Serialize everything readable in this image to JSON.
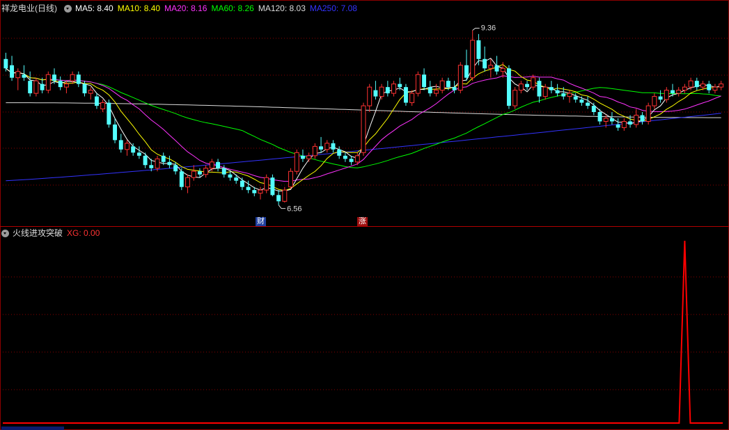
{
  "header": {
    "title": "祥龙电业(日线)",
    "ma": [
      {
        "label": "MA5: 8.40",
        "color": "#ffffff"
      },
      {
        "label": "MA10: 8.40",
        "color": "#ffff00"
      },
      {
        "label": "MA20: 8.16",
        "color": "#ff33ff"
      },
      {
        "label": "MA60: 8.26",
        "color": "#00ff00"
      },
      {
        "label": "MA120: 8.03",
        "color": "#dcdcdc"
      },
      {
        "label": "MA250: 7.08",
        "color": "#3333ff"
      }
    ]
  },
  "indicator": {
    "title": "火线进攻突破",
    "xg_label": "XG: 0.00",
    "xg_color": "#ff3333"
  },
  "annotations": {
    "high_label": "9.36",
    "low_label": "6.56",
    "badge_cai": "财",
    "badge_zhang": "涨"
  },
  "colors": {
    "up": "#ff3232",
    "down": "#54ffff",
    "grid": "#8b0000",
    "signal": "#ff0000"
  },
  "chart_data": {
    "type": "candlestick",
    "price_range": [
      6.3,
      9.6
    ],
    "high": 9.36,
    "low": 6.56,
    "candles": [
      [
        8.9,
        9.0,
        8.7,
        8.75
      ],
      [
        8.8,
        8.95,
        8.55,
        8.6
      ],
      [
        8.6,
        8.75,
        8.4,
        8.7
      ],
      [
        8.65,
        8.8,
        8.55,
        8.6
      ],
      [
        8.55,
        8.7,
        8.3,
        8.35
      ],
      [
        8.35,
        8.6,
        8.3,
        8.55
      ],
      [
        8.5,
        8.6,
        8.35,
        8.4
      ],
      [
        8.4,
        8.7,
        8.35,
        8.65
      ],
      [
        8.65,
        8.75,
        8.5,
        8.55
      ],
      [
        8.55,
        8.62,
        8.4,
        8.45
      ],
      [
        8.45,
        8.55,
        8.35,
        8.5
      ],
      [
        8.55,
        8.7,
        8.5,
        8.65
      ],
      [
        8.65,
        8.7,
        8.45,
        8.5
      ],
      [
        8.5,
        8.55,
        8.3,
        8.35
      ],
      [
        8.35,
        8.45,
        8.25,
        8.4
      ],
      [
        8.3,
        8.35,
        8.1,
        8.15
      ],
      [
        8.1,
        8.25,
        8.05,
        8.2
      ],
      [
        8.2,
        8.25,
        7.8,
        7.85
      ],
      [
        7.85,
        7.95,
        7.55,
        7.6
      ],
      [
        7.6,
        7.7,
        7.4,
        7.45
      ],
      [
        7.45,
        7.6,
        7.35,
        7.55
      ],
      [
        7.5,
        7.55,
        7.35,
        7.4
      ],
      [
        7.4,
        7.5,
        7.3,
        7.35
      ],
      [
        7.35,
        7.4,
        7.15,
        7.2
      ],
      [
        7.2,
        7.3,
        7.1,
        7.15
      ],
      [
        7.15,
        7.35,
        7.1,
        7.3
      ],
      [
        7.35,
        7.4,
        7.2,
        7.25
      ],
      [
        7.25,
        7.35,
        7.15,
        7.2
      ],
      [
        7.2,
        7.25,
        7.05,
        7.1
      ],
      [
        7.1,
        7.15,
        6.8,
        6.85
      ],
      [
        6.85,
        7.05,
        6.75,
        7.0
      ],
      [
        7.0,
        7.2,
        6.95,
        7.1
      ],
      [
        7.1,
        7.15,
        7.0,
        7.05
      ],
      [
        7.05,
        7.2,
        7.0,
        7.15
      ],
      [
        7.15,
        7.3,
        7.1,
        7.25
      ],
      [
        7.25,
        7.3,
        7.1,
        7.15
      ],
      [
        7.15,
        7.2,
        7.0,
        7.05
      ],
      [
        7.05,
        7.1,
        6.95,
        7.0
      ],
      [
        7.0,
        7.05,
        6.9,
        6.95
      ],
      [
        6.95,
        7.0,
        6.8,
        6.85
      ],
      [
        6.85,
        6.95,
        6.75,
        6.8
      ],
      [
        6.8,
        6.85,
        6.7,
        6.75
      ],
      [
        6.75,
        6.85,
        6.65,
        6.8
      ],
      [
        6.8,
        7.05,
        6.75,
        7.0
      ],
      [
        7.0,
        7.05,
        6.7,
        6.72
      ],
      [
        6.72,
        6.8,
        6.56,
        6.62
      ],
      [
        6.62,
        6.85,
        6.6,
        6.8
      ],
      [
        6.85,
        7.15,
        6.82,
        7.1
      ],
      [
        7.1,
        7.45,
        7.05,
        7.4
      ],
      [
        7.35,
        7.45,
        7.25,
        7.3
      ],
      [
        7.3,
        7.4,
        7.25,
        7.35
      ],
      [
        7.35,
        7.55,
        7.3,
        7.5
      ],
      [
        7.5,
        7.65,
        7.4,
        7.45
      ],
      [
        7.45,
        7.6,
        7.4,
        7.55
      ],
      [
        7.55,
        7.6,
        7.4,
        7.45
      ],
      [
        7.45,
        7.5,
        7.3,
        7.35
      ],
      [
        7.35,
        7.4,
        7.25,
        7.3
      ],
      [
        7.3,
        7.35,
        7.2,
        7.25
      ],
      [
        7.25,
        7.4,
        7.2,
        7.35
      ],
      [
        7.4,
        8.2,
        7.35,
        8.15
      ],
      [
        8.15,
        8.5,
        8.05,
        8.45
      ],
      [
        8.4,
        8.55,
        8.25,
        8.3
      ],
      [
        8.3,
        8.5,
        8.25,
        8.45
      ],
      [
        8.45,
        8.55,
        8.3,
        8.35
      ],
      [
        8.35,
        8.55,
        8.3,
        8.5
      ],
      [
        8.5,
        8.6,
        8.4,
        8.45
      ],
      [
        8.45,
        8.5,
        8.15,
        8.2
      ],
      [
        8.2,
        8.4,
        8.15,
        8.35
      ],
      [
        8.35,
        8.7,
        8.3,
        8.65
      ],
      [
        8.65,
        8.75,
        8.4,
        8.45
      ],
      [
        8.45,
        8.55,
        8.3,
        8.35
      ],
      [
        8.35,
        8.5,
        8.3,
        8.4
      ],
      [
        8.4,
        8.6,
        8.35,
        8.55
      ],
      [
        8.55,
        8.6,
        8.4,
        8.45
      ],
      [
        8.45,
        8.55,
        8.35,
        8.4
      ],
      [
        8.4,
        8.85,
        8.35,
        8.8
      ],
      [
        8.8,
        9.05,
        8.55,
        8.6
      ],
      [
        8.6,
        9.36,
        8.55,
        9.2
      ],
      [
        9.2,
        9.3,
        8.8,
        8.9
      ],
      [
        8.9,
        9.1,
        8.7,
        8.75
      ],
      [
        8.75,
        8.9,
        8.6,
        8.8
      ],
      [
        8.8,
        8.95,
        8.65,
        8.7
      ],
      [
        8.7,
        8.85,
        8.6,
        8.75
      ],
      [
        8.75,
        8.8,
        8.1,
        8.15
      ],
      [
        8.15,
        8.45,
        8.1,
        8.4
      ],
      [
        8.4,
        8.55,
        8.35,
        8.5
      ],
      [
        8.5,
        8.55,
        8.4,
        8.45
      ],
      [
        8.45,
        8.65,
        8.4,
        8.6
      ],
      [
        8.55,
        8.6,
        8.2,
        8.3
      ],
      [
        8.3,
        8.5,
        8.25,
        8.45
      ],
      [
        8.45,
        8.55,
        8.35,
        8.4
      ],
      [
        8.4,
        8.5,
        8.3,
        8.35
      ],
      [
        8.35,
        8.45,
        8.25,
        8.3
      ],
      [
        8.3,
        8.4,
        8.2,
        8.35
      ],
      [
        8.3,
        8.35,
        8.2,
        8.25
      ],
      [
        8.25,
        8.3,
        8.15,
        8.2
      ],
      [
        8.2,
        8.3,
        8.1,
        8.15
      ],
      [
        8.15,
        8.2,
        8.0,
        8.05
      ],
      [
        8.05,
        8.1,
        7.85,
        7.9
      ],
      [
        7.9,
        8.0,
        7.8,
        7.95
      ],
      [
        7.95,
        8.05,
        7.85,
        7.9
      ],
      [
        7.85,
        7.95,
        7.75,
        7.8
      ],
      [
        7.8,
        7.95,
        7.75,
        7.9
      ],
      [
        7.9,
        8.0,
        7.8,
        7.85
      ],
      [
        7.85,
        8.1,
        7.8,
        8.0
      ],
      [
        8.0,
        8.05,
        7.85,
        7.9
      ],
      [
        7.9,
        8.2,
        7.85,
        8.15
      ],
      [
        8.15,
        8.35,
        8.1,
        8.3
      ],
      [
        8.3,
        8.4,
        8.2,
        8.25
      ],
      [
        8.25,
        8.45,
        8.2,
        8.4
      ],
      [
        8.4,
        8.5,
        8.3,
        8.35
      ],
      [
        8.35,
        8.45,
        8.3,
        8.4
      ],
      [
        8.4,
        8.5,
        8.35,
        8.45
      ],
      [
        8.45,
        8.6,
        8.4,
        8.55
      ],
      [
        8.55,
        8.6,
        8.4,
        8.45
      ],
      [
        8.45,
        8.55,
        8.4,
        8.5
      ],
      [
        8.5,
        8.55,
        8.35,
        8.4
      ],
      [
        8.4,
        8.5,
        8.35,
        8.45
      ],
      [
        8.45,
        8.55,
        8.4,
        8.5
      ]
    ],
    "ma120_level": 8.08,
    "ma250_range": [
      6.95,
      8.03
    ],
    "xg_signal_index": 112
  }
}
